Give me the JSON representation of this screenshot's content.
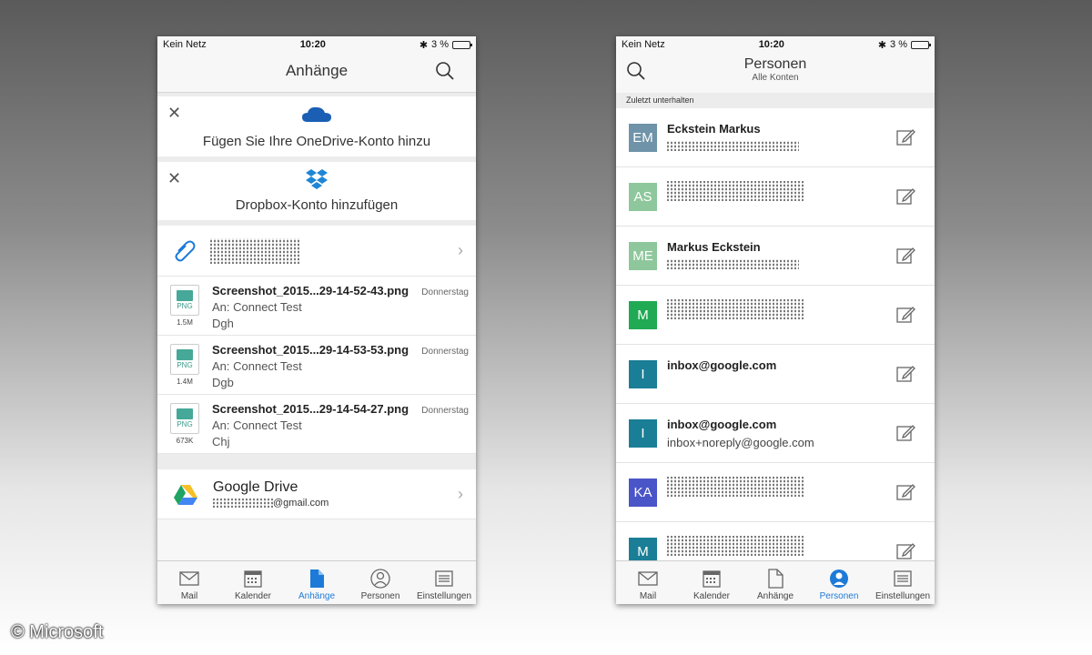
{
  "left": {
    "status": {
      "carrier": "Kein Netz",
      "time": "10:20",
      "battery": "3 %"
    },
    "title": "Anhänge",
    "onedrive_label": "Fügen Sie Ihre OneDrive-Konto hinzu",
    "dropbox_label": "Dropbox-Konto hinzufügen",
    "files": [
      {
        "name": "Screenshot_2015...29-14-52-43.png",
        "to": "An: Connect Test",
        "from": "Dgh",
        "day": "Donnerstag",
        "size": "1.5M",
        "type": "PNG"
      },
      {
        "name": "Screenshot_2015...29-14-53-53.png",
        "to": "An: Connect Test",
        "from": "Dgb",
        "day": "Donnerstag",
        "size": "1.4M",
        "type": "PNG"
      },
      {
        "name": "Screenshot_2015...29-14-54-27.png",
        "to": "An: Connect Test",
        "from": "Chj",
        "day": "Donnerstag",
        "size": "673K",
        "type": "PNG"
      }
    ],
    "gdrive": {
      "title": "Google Drive",
      "email_suffix": "@gmail.com"
    },
    "tabs": [
      "Mail",
      "Kalender",
      "Anhänge",
      "Personen",
      "Einstellungen"
    ]
  },
  "right": {
    "status": {
      "carrier": "Kein Netz",
      "time": "10:20",
      "battery": "3 %"
    },
    "title": "Personen",
    "subtitle": "Alle Konten",
    "section": "Zuletzt unterhalten",
    "people": [
      {
        "initials": "EM",
        "name": "Eckstein Markus",
        "email": "",
        "color": "#6f93a8"
      },
      {
        "initials": "AS",
        "name": "",
        "email": "",
        "color": "#8ec79b"
      },
      {
        "initials": "ME",
        "name": "Markus Eckstein",
        "email": "",
        "color": "#8ec79b"
      },
      {
        "initials": "M",
        "name": "",
        "email": "",
        "color": "#1faa53"
      },
      {
        "initials": "I",
        "name": "inbox@google.com",
        "email": "",
        "color": "#1a7e96"
      },
      {
        "initials": "I",
        "name": "inbox@google.com",
        "email": "inbox+noreply@google.com",
        "color": "#1a7e96"
      },
      {
        "initials": "KA",
        "name": "",
        "email": "",
        "color": "#4a55c7"
      },
      {
        "initials": "M",
        "name": "",
        "email": "",
        "color": "#1a7e96"
      }
    ],
    "tabs": [
      "Mail",
      "Kalender",
      "Anhänge",
      "Personen",
      "Einstellungen"
    ]
  },
  "copyright": "© Microsoft",
  "colors": {
    "accent": "#1d7ad8"
  }
}
